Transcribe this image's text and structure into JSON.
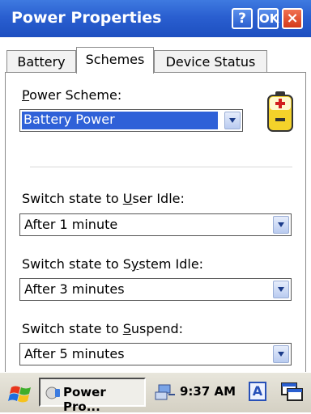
{
  "window": {
    "title": "Power Properties",
    "help_label": "?",
    "ok_label": "OK",
    "close_label": "×"
  },
  "tabs": [
    {
      "label": "Battery"
    },
    {
      "label": "Schemes",
      "selected": true
    },
    {
      "label": "Device Status"
    }
  ],
  "scheme": {
    "label_prefix": "",
    "label_u": "P",
    "label_rest": "ower Scheme:",
    "value": "Battery Power"
  },
  "user_idle": {
    "label_prefix": "Switch state to ",
    "label_u": "U",
    "label_rest": "ser Idle:",
    "value": "After 1 minute"
  },
  "system_idle": {
    "label_prefix": "Switch state to S",
    "label_u": "y",
    "label_rest": "stem Idle:",
    "value": "After 3 minutes"
  },
  "suspend": {
    "label_prefix": "Switch state to ",
    "label_u": "S",
    "label_rest": "uspend:",
    "value": "After 5 minutes"
  },
  "taskbar": {
    "task_label": "Power Pro...",
    "clock": "9:37 AM",
    "ime_label": "A"
  },
  "colors": {
    "titlebar": "#2a5fd0",
    "selection": "#2f61d8",
    "close": "#d43a1a"
  }
}
